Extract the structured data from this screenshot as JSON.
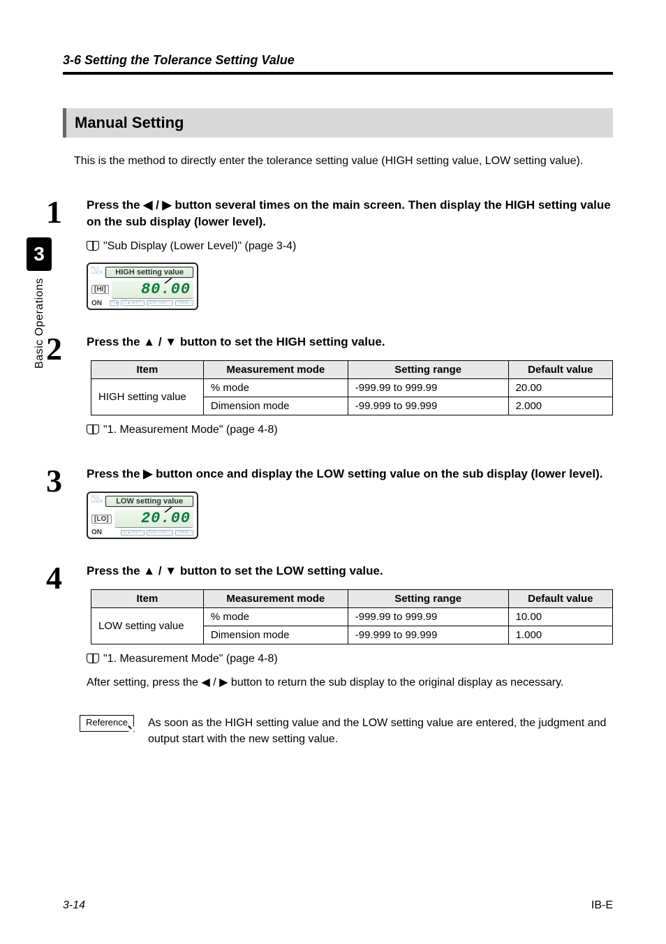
{
  "header": "3-6  Setting the Tolerance Setting Value",
  "sidebar": {
    "chapter": "3",
    "label": "Basic Operations"
  },
  "section_title": "Manual Setting",
  "intro": "This is the method to directly enter the tolerance setting value (HIGH setting value, LOW setting value).",
  "steps": {
    "s1": {
      "num": "1",
      "title_a": "Press the ",
      "title_b": " button several times on the main screen. Then display the HIGH setting value on the sub display (lower level).",
      "ref": "\"Sub Display (Lower Level)\" (page 3-4)",
      "diag_label": "HIGH setting value",
      "diag_chip": "[HI]",
      "diag_digits": "80.00",
      "diag_on": "ON"
    },
    "s2": {
      "num": "2",
      "title_a": "Press the ",
      "title_b": " button to set the HIGH setting value.",
      "ref": "\"1. Measurement Mode\" (page 4-8)"
    },
    "s3": {
      "num": "3",
      "title_a": "Press the ",
      "title_b": " button once and display the LOW setting value on the sub display (lower level).",
      "diag_label": "LOW setting value",
      "diag_chip": "[LO]",
      "diag_digits": "20.00",
      "diag_on": "ON"
    },
    "s4": {
      "num": "4",
      "title_a": "Press the ",
      "title_b": " button to set the LOW setting value.",
      "ref": "\"1. Measurement Mode\" (page 4-8)",
      "after_a": "After setting, press the ",
      "after_b": " button to return the sub display to the original display as necessary."
    }
  },
  "table_headers": {
    "item": "Item",
    "mode": "Measurement mode",
    "range": "Setting range",
    "def": "Default value"
  },
  "table_high": {
    "item": "HIGH setting value",
    "rows": [
      {
        "mode": "% mode",
        "range": "-999.99 to 999.99",
        "def": "20.00"
      },
      {
        "mode": "Dimension mode",
        "range": "-99.999 to 99.999",
        "def": "2.000"
      }
    ]
  },
  "table_low": {
    "item": "LOW setting value",
    "rows": [
      {
        "mode": "% mode",
        "range": "-999.99 to 999.99",
        "def": "10.00"
      },
      {
        "mode": "Dimension mode",
        "range": "-99.999 to 99.999",
        "def": "1.000"
      }
    ]
  },
  "reference": {
    "tag": "Reference",
    "text": "As soon as the HIGH setting value and the LOW setting value are entered, the judgment and output start with the new setting value."
  },
  "footer": {
    "left": "3-14",
    "right": "IB-E"
  },
  "arrows": {
    "lr": "◀ / ▶",
    "ud": "▲ / ▼",
    "r": "▶",
    "lr2": "◀ / ▶"
  }
}
